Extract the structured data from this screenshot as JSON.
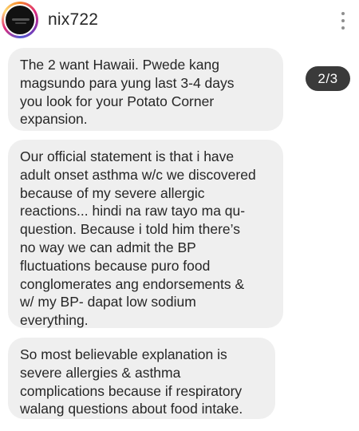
{
  "header": {
    "username": "nix722",
    "avatar_icon": "profile-avatar",
    "menu_icon": "more-options-vertical-icon"
  },
  "media_counter": "2/3",
  "messages": [
    {
      "text": "The 2 want Hawaii. Pwede kang\nmagsundo para yung last 3-4 days\nyou look for your Potato Corner\nexpansion."
    },
    {
      "text": "Our official statement is that i have\nadult onset asthma w/c we discovered\nbecause of my severe allergic\nreactions... hindi na raw tayo ma qu-\nquestion. Because i told him there’s\nno way we can admit the BP\nfluctuations because puro food\nconglomerates ang endorsements &\nw/ my BP- dapat low sodium\neverything."
    },
    {
      "text": "So most believable explanation is\nsevere allergies & asthma\ncomplications because if respiratory\nwalang questions about food intake."
    }
  ],
  "colors": {
    "bubble": "#efefef",
    "text": "#262626",
    "counter_bg": "#3a3a3a"
  }
}
